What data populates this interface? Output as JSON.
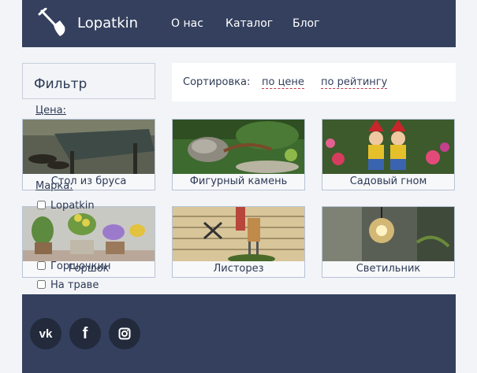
{
  "header": {
    "logo_text": "Lopatkin",
    "nav": [
      {
        "label": "О нас"
      },
      {
        "label": "Каталог"
      },
      {
        "label": "Блог"
      }
    ]
  },
  "filter": {
    "title": "Фильтр",
    "price_label": "Цена:",
    "brand_label": "Марка:",
    "brands": [
      {
        "label": "Lopatkin",
        "checked": false
      },
      {
        "label": "Горшочкин",
        "checked": false
      },
      {
        "label": "На траве",
        "checked": false
      }
    ]
  },
  "sort": {
    "label": "Сортировка:",
    "by_price": "по цене",
    "by_rating": "по рейтингу"
  },
  "products": [
    {
      "title": "Стол из бруса"
    },
    {
      "title": "Фигурный камень"
    },
    {
      "title": "Садовый гном"
    },
    {
      "title": "Горшок"
    },
    {
      "title": "Листорез"
    },
    {
      "title": "Светильник"
    }
  ],
  "footer": {
    "social": [
      {
        "icon": "vk-icon",
        "glyph": "vk"
      },
      {
        "icon": "facebook-icon",
        "glyph": "f"
      },
      {
        "icon": "instagram-icon",
        "glyph": ""
      }
    ]
  },
  "colors": {
    "header_bg": "#34405e",
    "page_bg": "#f2f4f7",
    "link_underline": "#c0394b"
  }
}
